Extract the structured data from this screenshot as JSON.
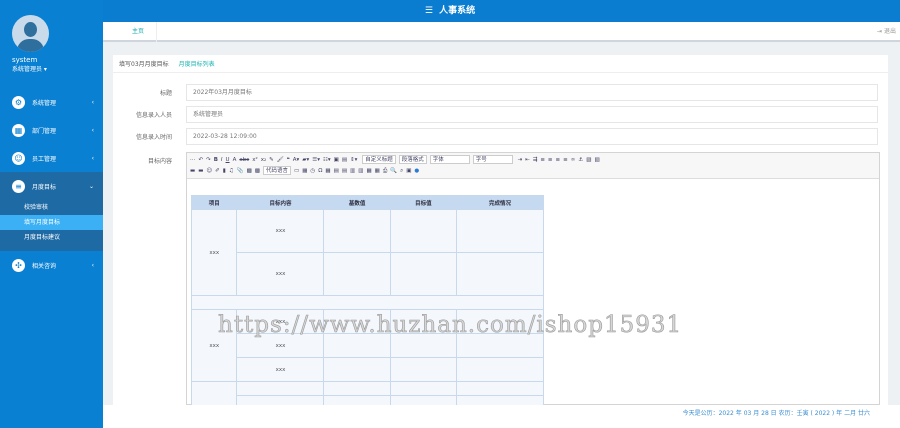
{
  "header": {
    "title": "人事系统",
    "menu_icon": "hamburger-icon"
  },
  "user": {
    "name": "system",
    "role": "系统管理员"
  },
  "sidebar": {
    "items": [
      {
        "label": "系统管理",
        "icon": "gear-icon"
      },
      {
        "label": "部门管理",
        "icon": "grid-icon"
      },
      {
        "label": "员工管理",
        "icon": "user-icon"
      },
      {
        "label": "月度目标",
        "icon": "list-icon",
        "children": [
          "校验审核",
          "填写月度目标",
          "月度目标建议"
        ]
      },
      {
        "label": "相关咨询",
        "icon": "fan-icon"
      }
    ]
  },
  "tabs": {
    "home": "主页",
    "logout": "退出"
  },
  "panel": {
    "title": "填写03月月度目标",
    "link": "月度目标列表"
  },
  "form": {
    "title_label": "标题",
    "title_value": "2022年03月月度目标",
    "entrant_label": "信息录入人员",
    "entrant_value": "系统管理员",
    "time_label": "信息录入时间",
    "time_value": "2022-03-28 12:09:00",
    "content_label": "目标内容"
  },
  "toolbar": {
    "selects": [
      "自定义标题",
      "段落格式",
      "字体",
      "字号",
      "代码语言"
    ]
  },
  "table": {
    "headers": [
      "项目",
      "目标内容",
      "基数值",
      "目标值",
      "完成情况"
    ],
    "cell": "xxx"
  },
  "watermark": "https://www.huzhan.com/ishop15931",
  "footer": {
    "text": "今天是公历：2022 年 03 月 28 日  农历：壬寅 ( 2022 ) 年  二月 廿六"
  }
}
